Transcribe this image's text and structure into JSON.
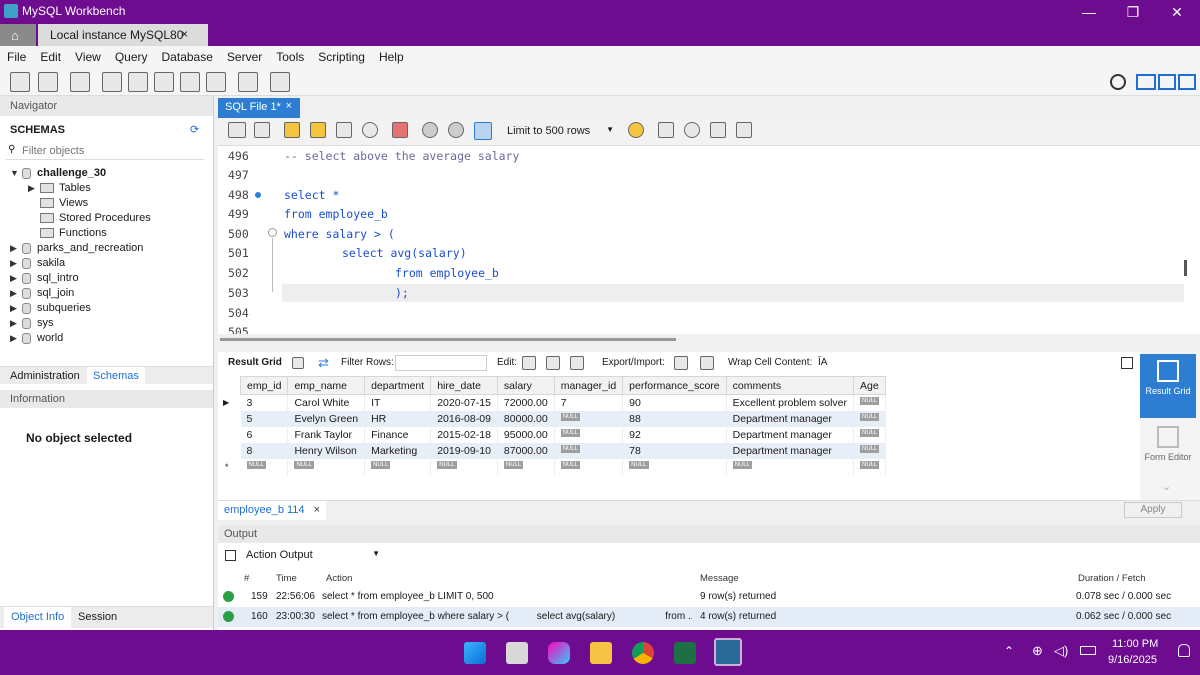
{
  "window": {
    "title": "MySQL Workbench",
    "tab": "Local instance MySQL80",
    "tab_close": "×",
    "minimize": "—",
    "maximize": "❐",
    "close": "✕"
  },
  "menu": [
    "File",
    "Edit",
    "View",
    "Query",
    "Database",
    "Server",
    "Tools",
    "Scripting",
    "Help"
  ],
  "navigator": {
    "title": "Navigator",
    "schemas_label": "SCHEMAS",
    "filter_placeholder": "Filter objects",
    "active_schema": "challenge_30",
    "children": [
      "Tables",
      "Views",
      "Stored Procedures",
      "Functions"
    ],
    "schemas": [
      "parks_and_recreation",
      "sakila",
      "sql_intro",
      "sql_join",
      "subqueries",
      "sys",
      "world"
    ],
    "tabs": [
      "Administration",
      "Schemas"
    ],
    "info_title": "Information",
    "no_object": "No object selected",
    "bottom_tabs": [
      "Object Info",
      "Session"
    ]
  },
  "editor": {
    "tab": "SQL File 1*",
    "tab_close": "×",
    "limit": "Limit to 500 rows",
    "lines": [
      {
        "n": "496",
        "text": "-- select above the average salary",
        "type": "comment"
      },
      {
        "n": "497",
        "text": ""
      },
      {
        "n": "498",
        "text": "select *"
      },
      {
        "n": "499",
        "text": "from employee_b"
      },
      {
        "n": "500",
        "text": "where salary > ("
      },
      {
        "n": "501",
        "text": "select avg(salary)"
      },
      {
        "n": "502",
        "text": "from employee_b"
      },
      {
        "n": "503",
        "text": ");"
      },
      {
        "n": "504",
        "text": ""
      },
      {
        "n": "505",
        "text": ""
      }
    ]
  },
  "result": {
    "tab_label": "Result Grid",
    "filter_label": "Filter Rows:",
    "edit_label": "Edit:",
    "export_label": "Export/Import:",
    "wrap_label": "Wrap Cell Content:",
    "columns": [
      "emp_id",
      "emp_name",
      "department",
      "hire_date",
      "salary",
      "manager_id",
      "performance_score",
      "comments",
      "Age"
    ],
    "rows": [
      [
        "3",
        "Carol White",
        "IT",
        "2020-07-15",
        "72000.00",
        "7",
        "90",
        "Excellent problem solver",
        "NULL"
      ],
      [
        "5",
        "Evelyn Green",
        "HR",
        "2016-08-09",
        "80000.00",
        "NULL",
        "88",
        "Department manager",
        "NULL"
      ],
      [
        "6",
        "Frank Taylor",
        "Finance",
        "2015-02-18",
        "95000.00",
        "NULL",
        "92",
        "Department manager",
        "NULL"
      ],
      [
        "8",
        "Henry Wilson",
        "Marketing",
        "2019-09-10",
        "87000.00",
        "NULL",
        "78",
        "Department manager",
        "NULL"
      ]
    ],
    "side": [
      "Result Grid",
      "Form Editor"
    ],
    "bottom_tab": "employee_b 114",
    "bottom_tab_close": "×",
    "apply": "Apply"
  },
  "output": {
    "title": "Output",
    "mode": "Action Output",
    "headers": [
      "#",
      "Time",
      "Action",
      "Message",
      "Duration / Fetch"
    ],
    "rows": [
      {
        "n": "159",
        "time": "22:56:06",
        "action": "select * from employee_b LIMIT 0, 500",
        "message": "9 row(s) returned",
        "duration": "0.078 sec / 0.000 sec"
      },
      {
        "n": "160",
        "time": "23:00:30",
        "action": "select * from employee_b where salary > (          select avg(salary)                  from ...",
        "message": "4 row(s) returned",
        "duration": "0.062 sec / 0.000 sec"
      }
    ]
  },
  "taskbar": {
    "time": "11:00 PM",
    "date": "9/16/2025"
  },
  "colors": {
    "titlebar": "#6d0c8f",
    "keyword": "#1a4fd0",
    "accent": "#1e88e5"
  }
}
